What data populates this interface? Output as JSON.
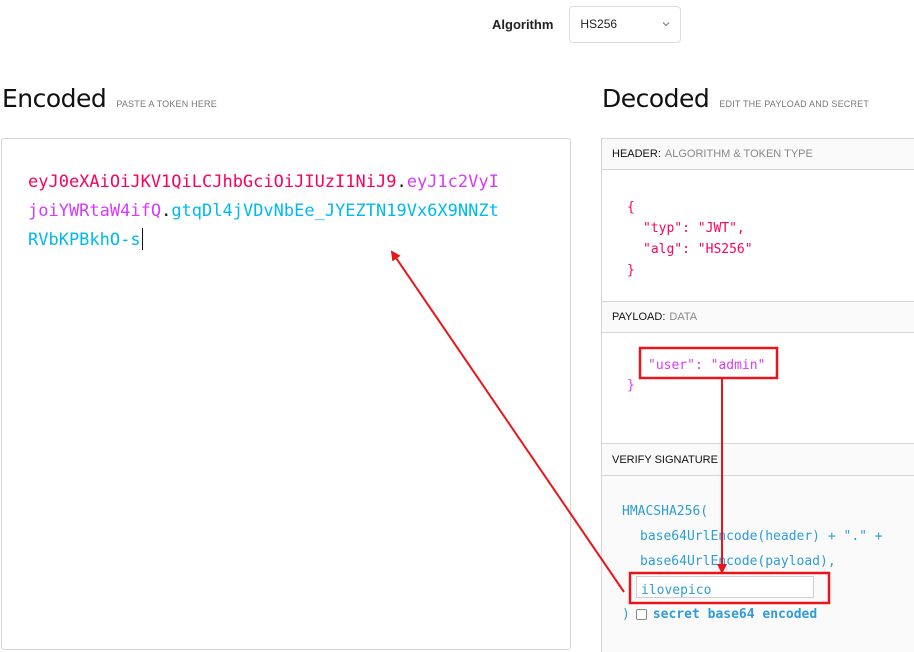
{
  "algorithm": {
    "label": "Algorithm",
    "selected": "HS256"
  },
  "encoded": {
    "title": "Encoded",
    "hint": "PASTE A TOKEN HERE"
  },
  "decoded": {
    "title": "Decoded",
    "hint": "EDIT THE PAYLOAD AND SECRET"
  },
  "token": {
    "header_part": "eyJ0eXAiOiJKV1QiLCJhbGciOiJIUzI1NiJ9",
    "payload_part": "eyJ1c2VyIjoiYWRtaW4ifQ",
    "signature_part": "gtqDl4jVDvNbEe_JYEZTN19Vx6X9NNZtRVbKPBkhO-s",
    "dot": "."
  },
  "header_section": {
    "label": "HEADER:",
    "sub": "ALGORITHM & TOKEN TYPE",
    "lines": [
      "{",
      "\"typ\": \"JWT\",",
      "\"alg\": \"HS256\"",
      "}"
    ]
  },
  "payload_section": {
    "label": "PAYLOAD:",
    "sub": "DATA",
    "line": "\"user\": \"admin\"",
    "close": "}"
  },
  "signature_section": {
    "label": "VERIFY SIGNATURE",
    "l1": "HMACSHA256(",
    "l2": "base64UrlEncode(header) + \".\" +",
    "l3": "base64UrlEncode(payload),",
    "secret": "ilovepico",
    "close": ")",
    "checkbox_label": "secret base64 encoded"
  },
  "colors": {
    "header": "#fb015b",
    "payload": "#d63aff",
    "signature": "#00b9f1",
    "annotation": "#e8161b"
  }
}
